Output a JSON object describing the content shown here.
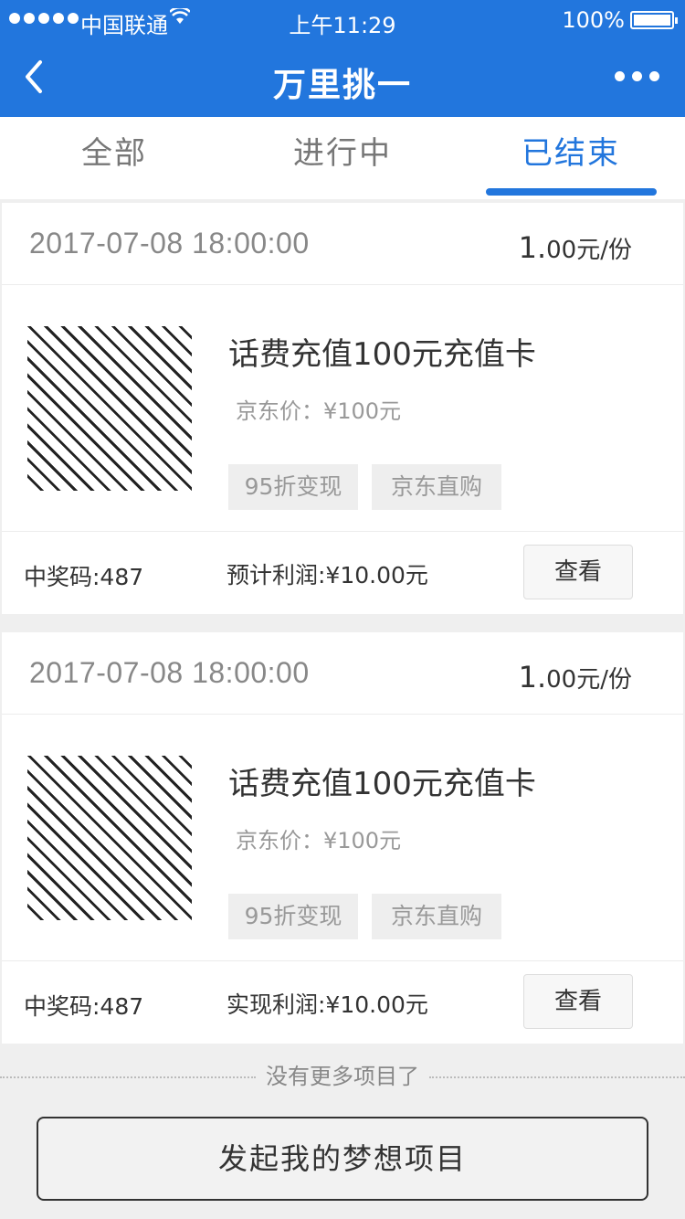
{
  "status_bar": {
    "carrier": "中国联通",
    "time": "上午11:29",
    "battery": "100%"
  },
  "nav": {
    "title": "万里挑一"
  },
  "tabs": [
    {
      "label": "全部"
    },
    {
      "label": "进行中"
    },
    {
      "label": "已结束",
      "active": true
    }
  ],
  "cards": [
    {
      "date": "2017-07-08 18:00:00",
      "price_big": "1.",
      "price_rest": "00元/份",
      "name": "话费充值100元充值卡",
      "jd_price": "京东价：¥100元",
      "tags": [
        "95折变现",
        "京东直购"
      ],
      "code": "中奖码:487",
      "profit": "预计利润:¥10.00元",
      "view_label": "查看"
    },
    {
      "date": "2017-07-08 18:00:00",
      "price_big": "1.",
      "price_rest": "00元/份",
      "name": "话费充值100元充值卡",
      "jd_price": "京东价：¥100元",
      "tags": [
        "95折变现",
        "京东直购"
      ],
      "code": "中奖码:487",
      "profit": "实现利润:¥10.00元",
      "view_label": "查看"
    }
  ],
  "footer": {
    "no_more": "没有更多项目了",
    "launch_label": "发起我的梦想项目"
  },
  "colors": {
    "brand": "#2276dd"
  }
}
